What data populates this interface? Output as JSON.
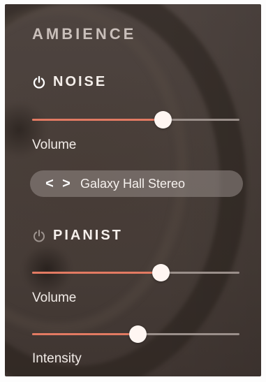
{
  "section": {
    "title": "AMBIENCE"
  },
  "noise": {
    "title": "NOISE",
    "power_on": true,
    "volume": {
      "label": "Volume",
      "value": 0.63
    },
    "preset": {
      "prev_label": "<",
      "next_label": ">",
      "name": "Galaxy Hall Stereo"
    }
  },
  "pianist": {
    "title": "PIANIST",
    "power_on": false,
    "volume": {
      "label": "Volume",
      "value": 0.62
    },
    "intensity": {
      "label": "Intensity",
      "value": 0.51
    }
  },
  "colors": {
    "accent": "#e27a62",
    "track": "#9a8f8a",
    "thumb": "#fff6f2",
    "power_on": "#ffffff",
    "power_off": "#9d938e"
  }
}
